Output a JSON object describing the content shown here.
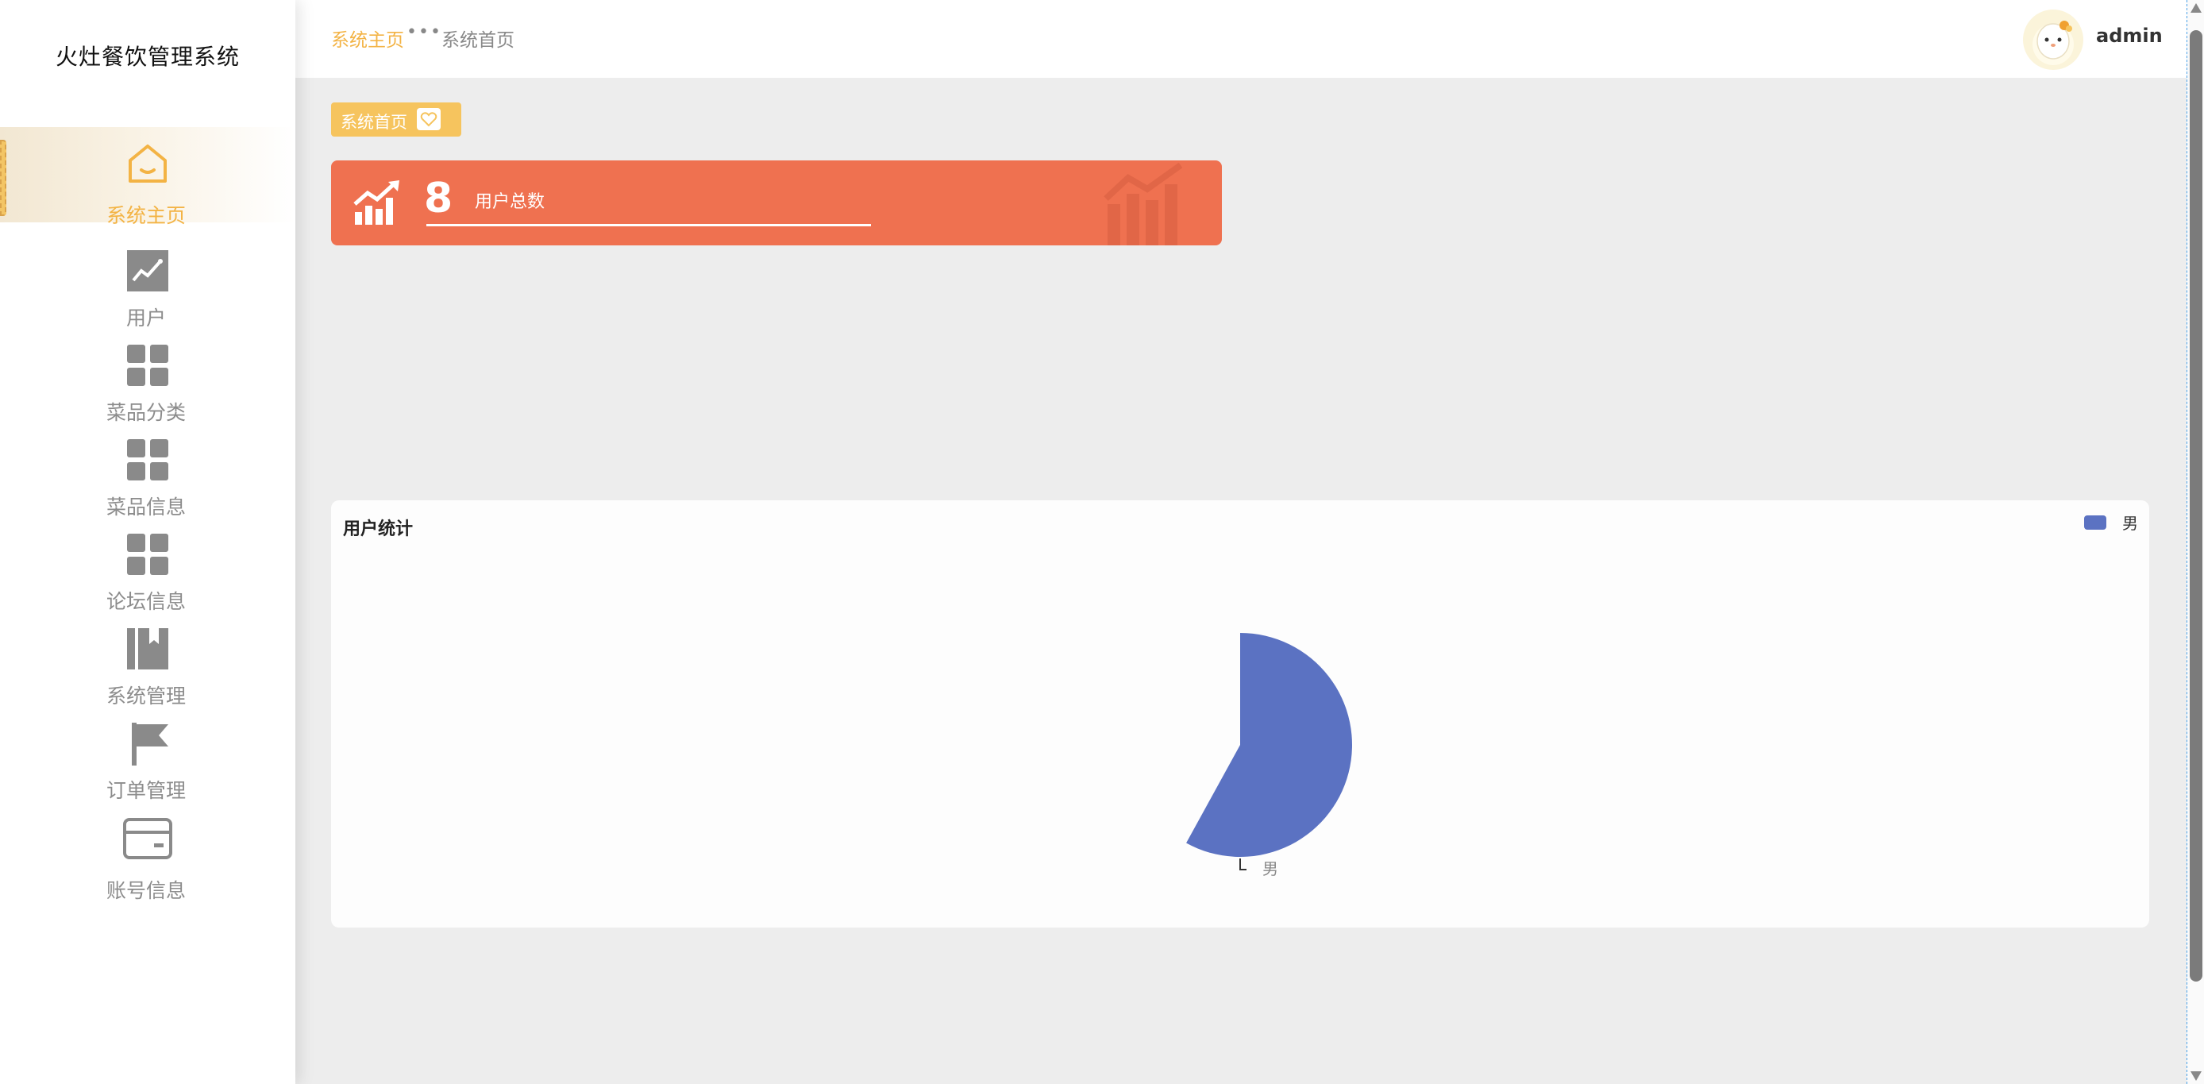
{
  "sidebar": {
    "brand": "火灶餐饮管理系统",
    "items": [
      {
        "label": "系统主页",
        "icon": "home-icon"
      },
      {
        "label": "用户",
        "icon": "trend-chart-icon"
      },
      {
        "label": "菜品分类",
        "icon": "grid-icon"
      },
      {
        "label": "菜品信息",
        "icon": "grid-icon"
      },
      {
        "label": "论坛信息",
        "icon": "grid-icon"
      },
      {
        "label": "系统管理",
        "icon": "book-bookmark-icon"
      },
      {
        "label": "订单管理",
        "icon": "flag-icon"
      },
      {
        "label": "账号信息",
        "icon": "card-icon"
      }
    ]
  },
  "header": {
    "breadcrumb_root": "系统主页",
    "breadcrumb_separator": "•••",
    "breadcrumb_current": "系统首页",
    "username": "admin"
  },
  "tag": {
    "label": "系统首页"
  },
  "stat_card": {
    "value": "8",
    "label": "用户总数",
    "color": "#ef7150"
  },
  "chart_panel": {
    "title": "用户统计"
  },
  "chart_data": {
    "type": "pie",
    "title": "用户统计",
    "categories": [
      "男"
    ],
    "values": [
      8
    ],
    "legend_position": "top-right",
    "colors": [
      "#5b72c2"
    ]
  },
  "colors": {
    "accent": "#f3b344",
    "tag_bg": "#f6c45e",
    "pie": "#5b72c2"
  }
}
